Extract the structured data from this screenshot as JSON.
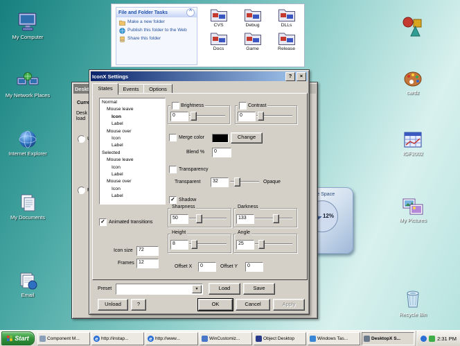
{
  "icons": {
    "help": "?",
    "close": "×",
    "dropdown": "▼",
    "check": "✓",
    "chevron": "^",
    "ie": "e"
  },
  "desktop": {
    "icons_left": [
      {
        "label": "My Computer"
      },
      {
        "label": "My Network Places"
      },
      {
        "label": "Internet Explorer"
      },
      {
        "label": "My Documents"
      },
      {
        "label": "Email"
      }
    ],
    "icons_right": [
      {
        "label": "cardz"
      },
      {
        "label": "IGF2002"
      },
      {
        "label": "My Pictures"
      },
      {
        "label": "Recycle Bin"
      }
    ]
  },
  "folder_window": {
    "tasks_title": "File and Folder Tasks",
    "task_items": [
      {
        "label": "Make a new folder"
      },
      {
        "label": "Publish this folder to the Web"
      },
      {
        "label": "Share this folder"
      }
    ],
    "folders": [
      {
        "label": "CVS"
      },
      {
        "label": "Debug"
      },
      {
        "label": "DLLs"
      },
      {
        "label": "Docs"
      },
      {
        "label": "Game"
      },
      {
        "label": "Release"
      }
    ]
  },
  "desktopx": {
    "title": "DesktopX",
    "text1": "Current",
    "text2": "Desk",
    "text3": "load",
    "radio1": "U",
    "radio2": "P"
  },
  "iconx": {
    "title": "IconX Settings",
    "tabs": [
      {
        "label": "States"
      },
      {
        "label": "Events"
      },
      {
        "label": "Options"
      }
    ],
    "states": [
      {
        "label": "Normal"
      },
      {
        "label": "Mouse leave"
      },
      {
        "label": "Icon"
      },
      {
        "label": "Label"
      },
      {
        "label": "Mouse over"
      },
      {
        "label": "Icon"
      },
      {
        "label": "Label"
      },
      {
        "label": "Selected"
      },
      {
        "label": "Mouse leave"
      },
      {
        "label": "Icon"
      },
      {
        "label": "Label"
      },
      {
        "label": "Mouse over"
      },
      {
        "label": "Icon"
      },
      {
        "label": "Label"
      }
    ],
    "brightness": {
      "label": "Brightness",
      "value": "0"
    },
    "contrast": {
      "label": "Contrast",
      "value": "0"
    },
    "merge_color": {
      "label": "Merge color",
      "button": "Change",
      "blend_label": "Blend %",
      "blend_value": "0"
    },
    "transparency": {
      "label": "Transparency",
      "left_label": "Transparent",
      "value": "32",
      "right_label": "Opaque"
    },
    "shadow": {
      "label": "Shadow",
      "sharpness": {
        "label": "Sharpness",
        "value": "50"
      },
      "darkness": {
        "label": "Darkness",
        "value": "133"
      },
      "height": {
        "label": "Height",
        "value": "8"
      },
      "angle": {
        "label": "Angle",
        "value": "25"
      }
    },
    "animated": {
      "label": "Animated transitions"
    },
    "icon_size": {
      "label": "Icon size",
      "value": "72"
    },
    "frames": {
      "label": "Frames",
      "value": "12"
    },
    "offset_x": {
      "label": "Offset X",
      "value": "0"
    },
    "offset_y": {
      "label": "Offset Y",
      "value": "0"
    },
    "preset": {
      "label": "Preset",
      "load": "Load",
      "save": "Save"
    },
    "buttons": {
      "unload": "Unload",
      "help": "?",
      "ok": "OK",
      "cancel": "Cancel",
      "apply": "Apply"
    }
  },
  "widget": {
    "title": "Free Space",
    "percent": "12%"
  },
  "taskbar": {
    "start": "Start",
    "items": [
      {
        "label": "Component M..."
      },
      {
        "label": "http://instap..."
      },
      {
        "label": "http://www..."
      },
      {
        "label": "WinCustomiz..."
      },
      {
        "label": "Object Desktop"
      },
      {
        "label": "Windows Tas..."
      },
      {
        "label": "DesktopX S..."
      }
    ],
    "clock": "2:31 PM"
  }
}
